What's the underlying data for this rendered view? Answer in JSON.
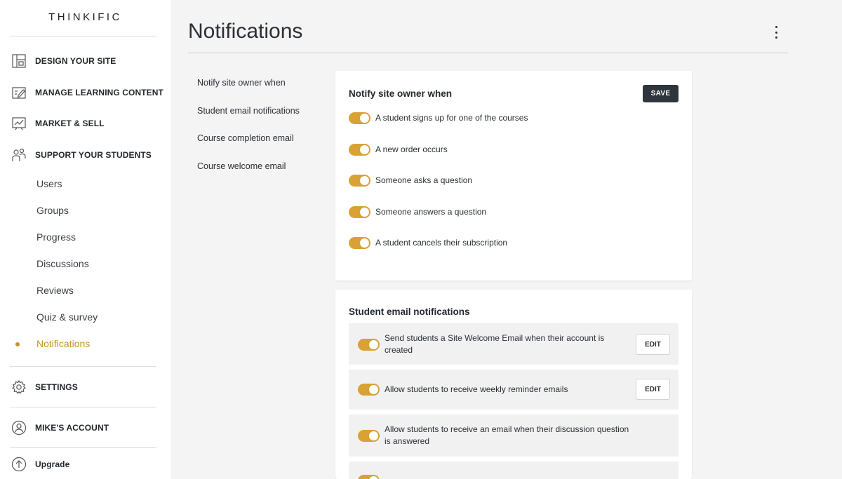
{
  "app": {
    "logo": "THINKIFIC"
  },
  "sidebar": {
    "main_items": [
      {
        "label": "DESIGN YOUR SITE",
        "icon": "layout-icon"
      },
      {
        "label": "MANAGE LEARNING CONTENT",
        "icon": "edit-content-icon"
      },
      {
        "label": "MARKET & SELL",
        "icon": "chart-icon"
      },
      {
        "label": "SUPPORT YOUR STUDENTS",
        "icon": "people-icon"
      }
    ],
    "sub_items": [
      {
        "label": "Users"
      },
      {
        "label": "Groups"
      },
      {
        "label": "Progress"
      },
      {
        "label": "Discussions"
      },
      {
        "label": "Reviews"
      },
      {
        "label": "Quiz & survey"
      },
      {
        "label": "Notifications",
        "active": true
      }
    ],
    "settings": {
      "label": "SETTINGS",
      "icon": "gear-icon"
    },
    "account": {
      "label": "MIKE'S ACCOUNT",
      "icon": "user-circle-icon"
    },
    "upgrade": {
      "label": "Upgrade",
      "icon": "arrow-up-circle-icon"
    }
  },
  "header": {
    "title": "Notifications",
    "menu_icon": "kebab-menu-icon"
  },
  "section_nav": [
    "Notify site owner when",
    "Student email notifications",
    "Course completion email",
    "Course welcome email"
  ],
  "owner_card": {
    "title": "Notify site owner when",
    "save_label": "SAVE",
    "toggles": [
      {
        "label": "A student signs up for one of the courses",
        "on": true
      },
      {
        "label": "A new order occurs",
        "on": true
      },
      {
        "label": "Someone asks a question",
        "on": true
      },
      {
        "label": "Someone answers a question",
        "on": true
      },
      {
        "label": "A student cancels their subscription",
        "on": true
      }
    ]
  },
  "student_card": {
    "title": "Student email notifications",
    "edit_label": "EDIT",
    "rows": [
      {
        "line1": "Send students a Site Welcome Email when their account is",
        "line2": "created",
        "on": true
      },
      {
        "line1": "Allow students to receive weekly reminder emails",
        "on": true
      },
      {
        "line1": "Allow students to receive an email when their discussion question",
        "line2": "is answered",
        "on": true
      }
    ]
  },
  "colors": {
    "accent": "#c8912b",
    "toggle_on": "#d9a235",
    "dark_button": "#2f353c"
  }
}
